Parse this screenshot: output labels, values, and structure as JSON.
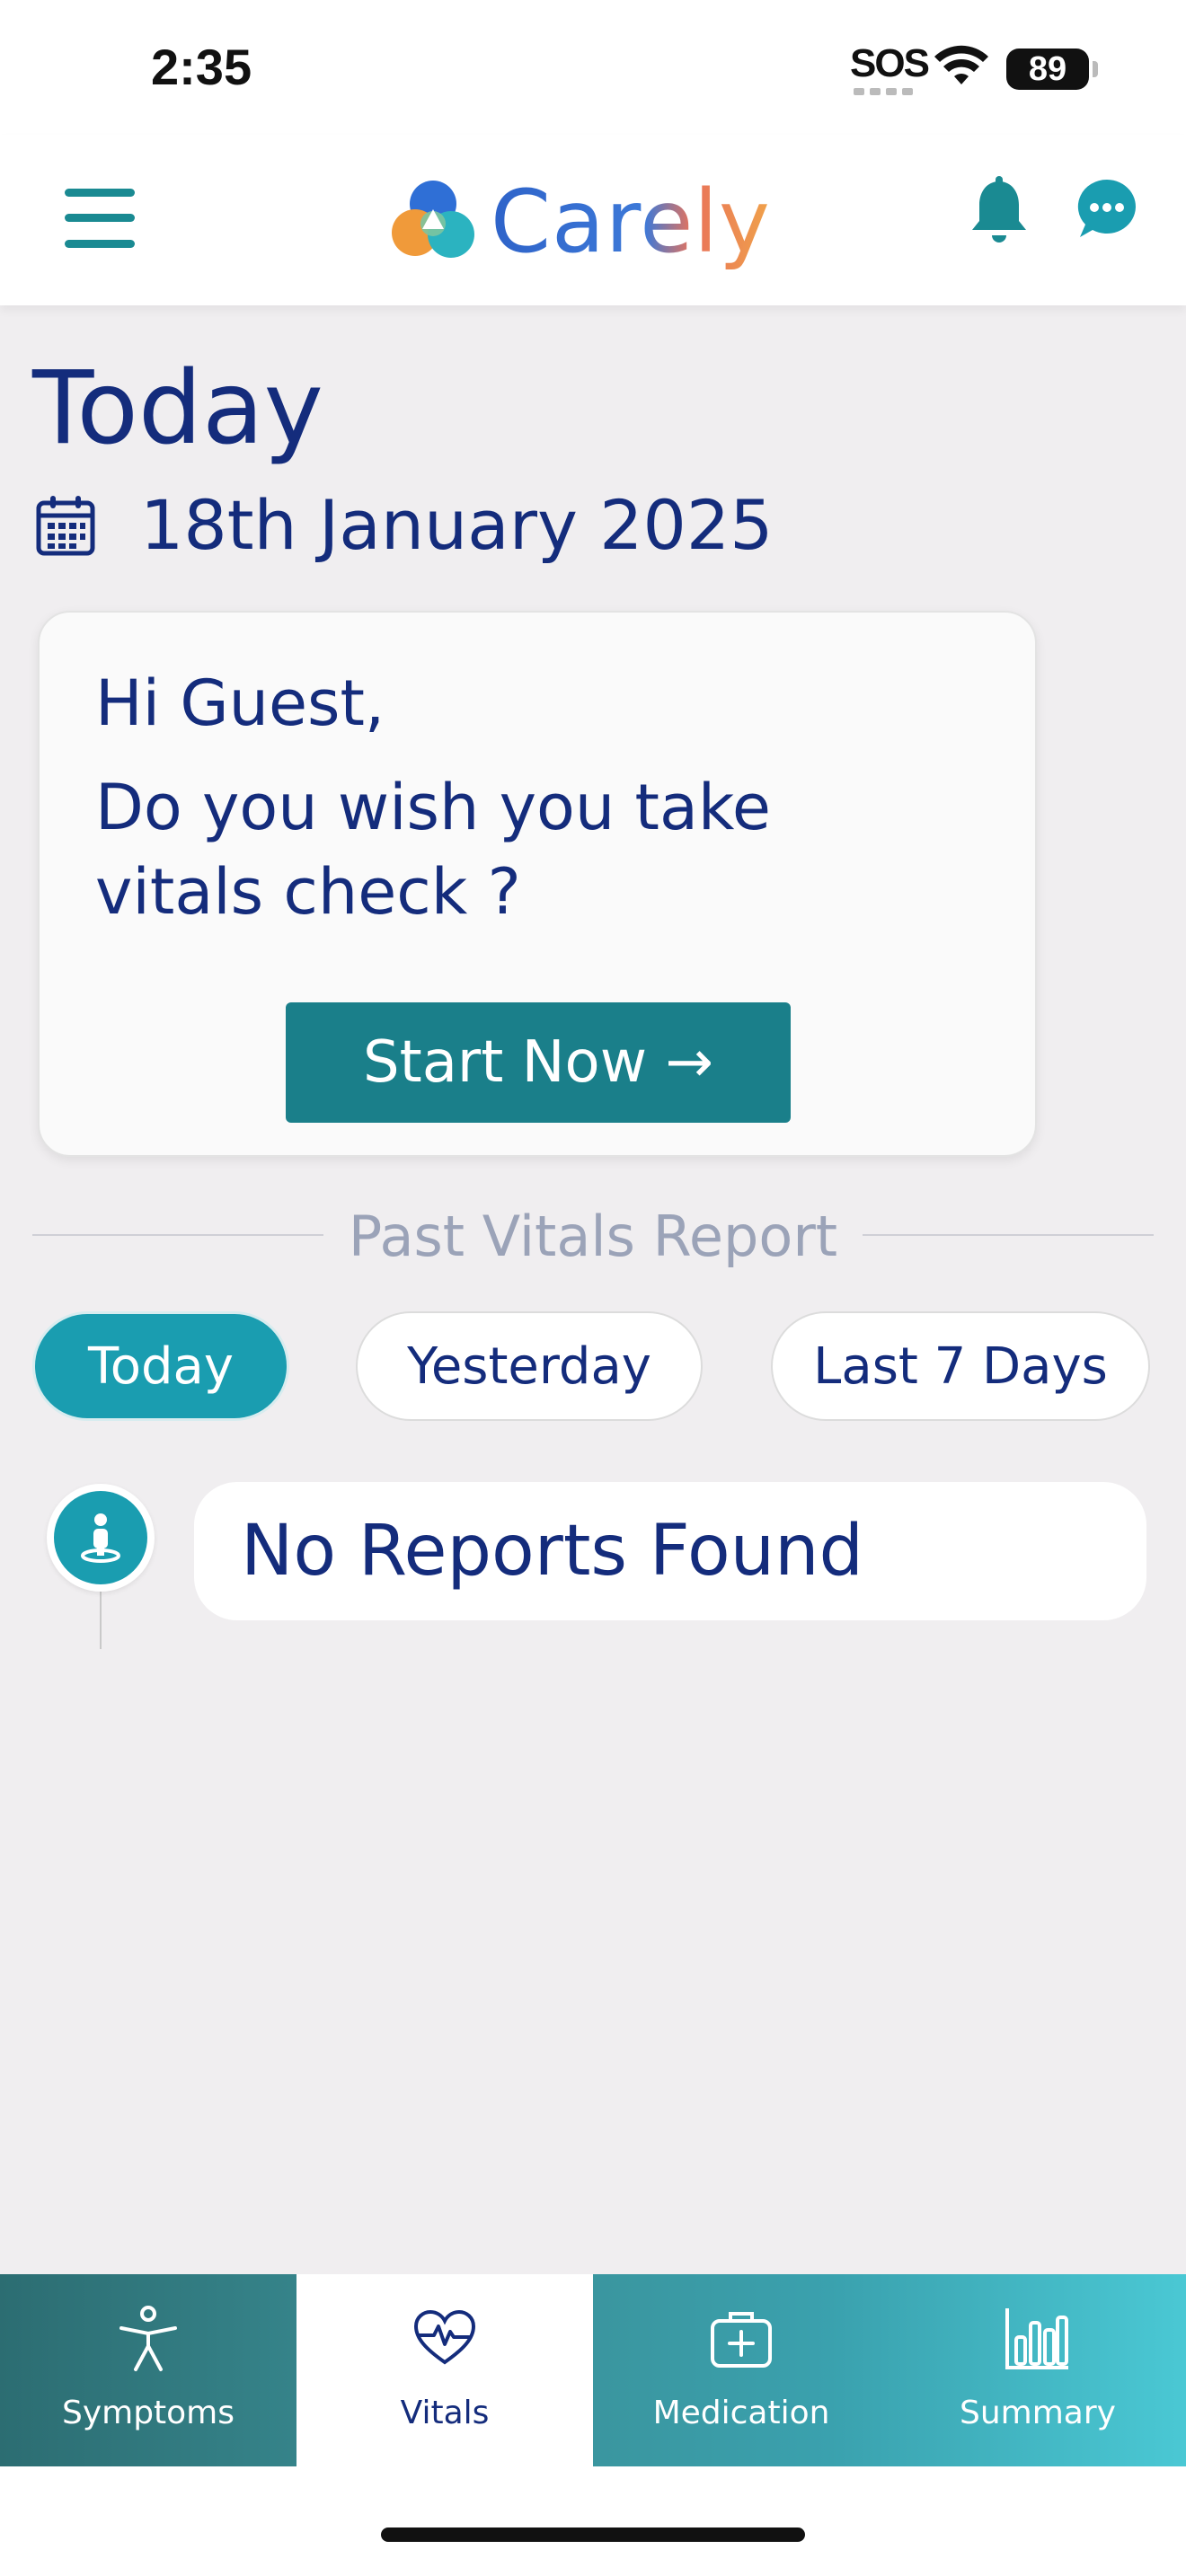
{
  "status_bar": {
    "time": "2:35",
    "sos": "SOS",
    "battery": "89"
  },
  "header": {
    "brand": "Carely",
    "icons": [
      "menu-icon",
      "logo-icon",
      "bell-icon",
      "chat-icon"
    ]
  },
  "main": {
    "title": "Today",
    "date": "18th January 2025",
    "greeting": "Hi Guest,",
    "question": "Do you wish you take vitals check ?",
    "cta_label": "Start Now →",
    "section_title": "Past Vitals Report",
    "range_tabs": [
      {
        "label": "Today",
        "active": true
      },
      {
        "label": "Yesterday",
        "active": false
      },
      {
        "label": "Last 7 Days",
        "active": false
      }
    ],
    "empty_state": "No Reports Found"
  },
  "bottom_nav": {
    "items": [
      {
        "label": "Symptoms",
        "icon": "person-accessibility-icon",
        "active": false
      },
      {
        "label": "Vitals",
        "icon": "heart-pulse-icon",
        "active": true
      },
      {
        "label": "Medication",
        "icon": "medkit-icon",
        "active": false
      },
      {
        "label": "Summary",
        "icon": "bar-chart-icon",
        "active": false
      }
    ]
  },
  "colors": {
    "primary": "#1a7f8a",
    "accent": "#1a9db0",
    "text": "#142c7c",
    "muted": "#9ba3b8"
  }
}
